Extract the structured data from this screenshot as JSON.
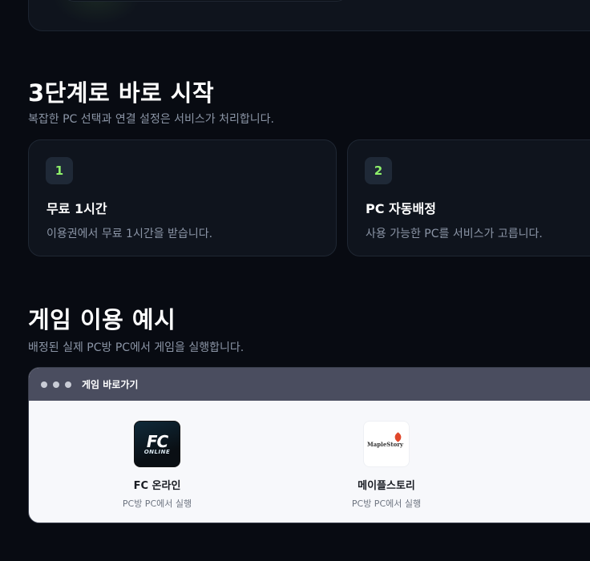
{
  "steps_section": {
    "title": "3단계로 바로 시작",
    "subtitle": "복잡한 PC 선택과 연결 설정은 서비스가 처리합니다.",
    "steps": [
      {
        "number": "1",
        "title": "무료 1시간",
        "description": "이용권에서 무료 1시간을 받습니다."
      },
      {
        "number": "2",
        "title": "PC 자동배정",
        "description": "사용 가능한 PC를 서비스가 고릅니다."
      }
    ]
  },
  "games_section": {
    "title": "게임 이용 예시",
    "subtitle": "배정된 실제 PC방 PC에서 게임을 실행합니다.",
    "window": {
      "title": "게임 바로가기",
      "games": [
        {
          "name": "FC 온라인",
          "caption": "PC방 PC에서 실행",
          "icon": "fc-online-icon",
          "icon_text": "FC",
          "icon_subtext": "ONLINE"
        },
        {
          "name": "메이플스토리",
          "caption": "PC방 PC에서 실행",
          "icon": "maplestory-icon",
          "icon_text": "MapleStory"
        }
      ],
      "cut_off_caption": "PC"
    }
  },
  "colors": {
    "background": "#080b12",
    "card": "#0f141d",
    "accent_green": "#8ef06a",
    "titlebar": "#4a4d5f",
    "window_body": "#f7f8fb"
  }
}
